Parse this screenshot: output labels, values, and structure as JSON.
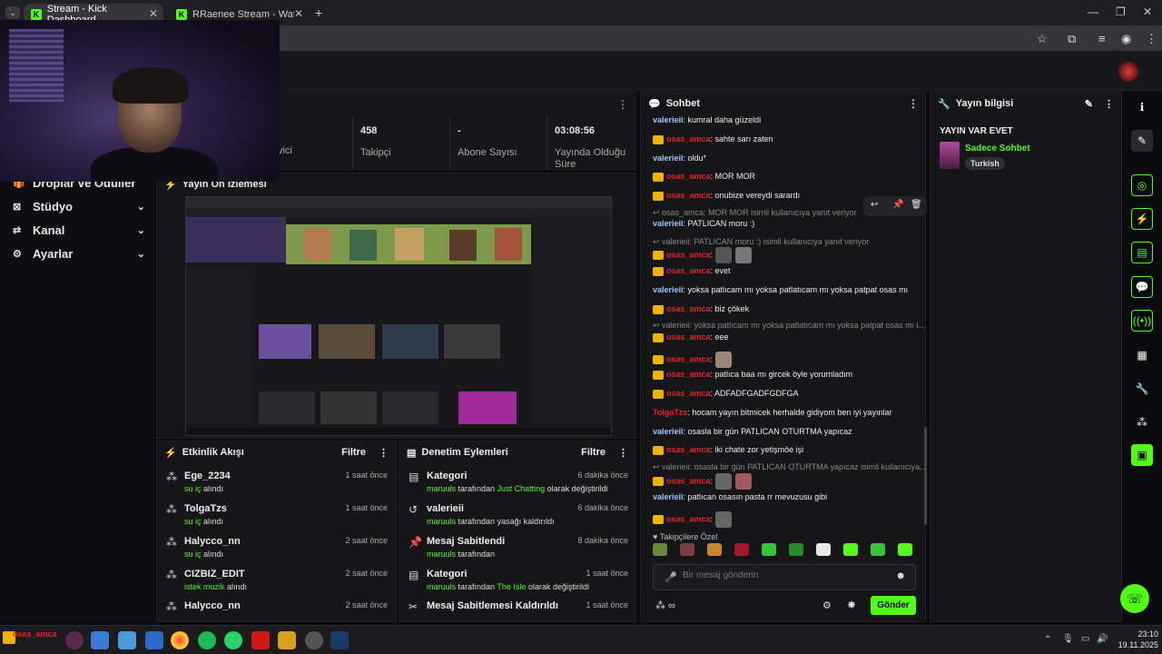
{
  "browser": {
    "tabs": [
      {
        "label": "Stream - Kick Dashboard",
        "active": true
      },
      {
        "label": "RRaenee Stream - Watch Live o",
        "active": false
      }
    ],
    "new_tab": "+"
  },
  "nav": {
    "items": [
      {
        "label": "Droplar ve Ödüller"
      },
      {
        "label": "Stüdyo"
      },
      {
        "label": "Kanal"
      },
      {
        "label": "Ayarlar"
      }
    ]
  },
  "stats": {
    "partial_label": "vici",
    "followers": {
      "value": "458",
      "label": "Takipçi"
    },
    "subs": {
      "value": "-",
      "label": "Abone Sayısı"
    },
    "uptime": {
      "value": "03:08:56",
      "label": "Yayında Olduğu Süre"
    }
  },
  "preview": {
    "title": "Yayın Ön İzlemesi"
  },
  "activity": {
    "title": "Etkinlik Akışı",
    "filter": "Filtre",
    "items": [
      {
        "name": "Ege_2234",
        "action": "su iç",
        "suffix": "alındı",
        "time": "1 saat önce"
      },
      {
        "name": "TolgaTzs",
        "action": "su iç",
        "suffix": "alındı",
        "time": "1 saat önce"
      },
      {
        "name": "Halycco_nn",
        "action": "su iç",
        "suffix": "alındı",
        "time": "2 saat önce"
      },
      {
        "name": "CIZBIZ_EDIT",
        "action": "istek muzik",
        "suffix": "alındı",
        "time": "2 saat önce"
      },
      {
        "name": "Halycco_nn",
        "action": "",
        "suffix": "",
        "time": "2 saat önce"
      }
    ]
  },
  "moderation": {
    "title": "Denetim Eylemleri",
    "filter": "Filtre",
    "items": [
      {
        "title": "Kategori",
        "user": "maruuls",
        "mid": "tarafından",
        "target": "Just Chatting",
        "end": "olarak değiştirildi",
        "time": "6 dakika önce"
      },
      {
        "title": "valerieii",
        "user": "maruuls",
        "mid": "tarafından yasağı kaldırıldı",
        "target": "",
        "end": "",
        "time": "6 dakika önce"
      },
      {
        "title": "Mesaj Sabitlendi",
        "user": "maruuls",
        "mid": "tarafından",
        "target": "",
        "end": "",
        "time": "8 dakika önce"
      },
      {
        "title": "Kategori",
        "user": "maruuls",
        "mid": "tarafından",
        "target": "The Isle",
        "end": "olarak değiştirildi",
        "time": "1 saat önce"
      },
      {
        "title": "Mesaj Sabitlemesi Kaldırıldı",
        "user": "",
        "mid": "",
        "target": "",
        "end": "",
        "time": "1 saat önce"
      }
    ]
  },
  "chat": {
    "title": "Sohbet",
    "lines": [
      {
        "user": "valerieii",
        "kind": "val",
        "text": ": kumral daha güzeldi"
      },
      {
        "user": "osas_amca",
        "kind": "amca",
        "text": ": sahte sarı zaten"
      },
      {
        "user": "valerieii",
        "kind": "val",
        "text": ": oldu*"
      },
      {
        "user": "osas_amca",
        "kind": "amca",
        "text": ": MOR MOR"
      },
      {
        "user": "osas_amca",
        "kind": "amca",
        "text": ": onubize vereydi sarardı"
      },
      {
        "user": "valerieii",
        "kind": "val",
        "text": ": PATLICAN moru :)"
      },
      {
        "user": "osas_amca",
        "kind": "amca",
        "text": ":"
      },
      {
        "user": "osas_amca",
        "kind": "amca",
        "text": ": evet"
      },
      {
        "user": "valerieii",
        "kind": "val",
        "text": ": yoksa patlıcam mı yoksa patlatıcam mı yoksa patpat osas mı"
      },
      {
        "user": "osas_amca",
        "kind": "amca",
        "text": ": biz çökek"
      },
      {
        "user": "osas_amca",
        "kind": "amca",
        "text": ": eee"
      },
      {
        "user": "osas_amca",
        "kind": "amca",
        "text": ":"
      },
      {
        "user": "osas_amca",
        "kind": "amca",
        "text": ": patlıca baa mı gircek öyle yorumladım"
      },
      {
        "user": "osas_amca",
        "kind": "amca",
        "text": ": ADFADFGADFGDFGA"
      },
      {
        "user": "TolgaTzs",
        "kind": "tol",
        "text": ": hocam yayın bitmicek herhalde gidiyom ben iyi yayınlar"
      },
      {
        "user": "valerieii",
        "kind": "val",
        "text": ": osasla bir gün PATLICAN OTURTMA yapıcaz"
      },
      {
        "user": "osas_amca",
        "kind": "amca",
        "text": ": iki chate zor yetişmöe işi"
      },
      {
        "user": "osas_amca",
        "kind": "amca",
        "text": ":"
      },
      {
        "user": "valerieii",
        "kind": "val",
        "text": ": patlıcan osasın pasta rr mevuzusu gibi"
      },
      {
        "user": "osas_amca",
        "kind": "amca",
        "text": ":"
      }
    ],
    "replies": [
      "osas_amca: MOR MOR isimli kullanıcıya yanıt veriyor",
      "valerieii: PATLICAN moru :) isimli kullanıcıya yanıt veriyor",
      "valerieii: yoksa patlıcam mı yoksa patlatıcam mı yoksa patpat osas mı i...",
      "valerieii: osasla bir gün PATLICAN OTURTMA yapıcaz isimli kullanıcıya..."
    ],
    "followers_only": "Takipçilere Özel",
    "placeholder": "Bir mesaj gönderin",
    "send": "Gönder"
  },
  "info": {
    "title": "Yayın bilgisi",
    "stream_title": "YAYIN VAR EVET",
    "category": "Sadece Sohbet",
    "language": "Turkish"
  },
  "taskbar": {
    "time": "23:10",
    "date": "19.11.2025",
    "user_label": "osas_amca"
  },
  "colors": {
    "accent": "#53fc18",
    "crown": "#f0b400",
    "amca": "#e0242a"
  }
}
